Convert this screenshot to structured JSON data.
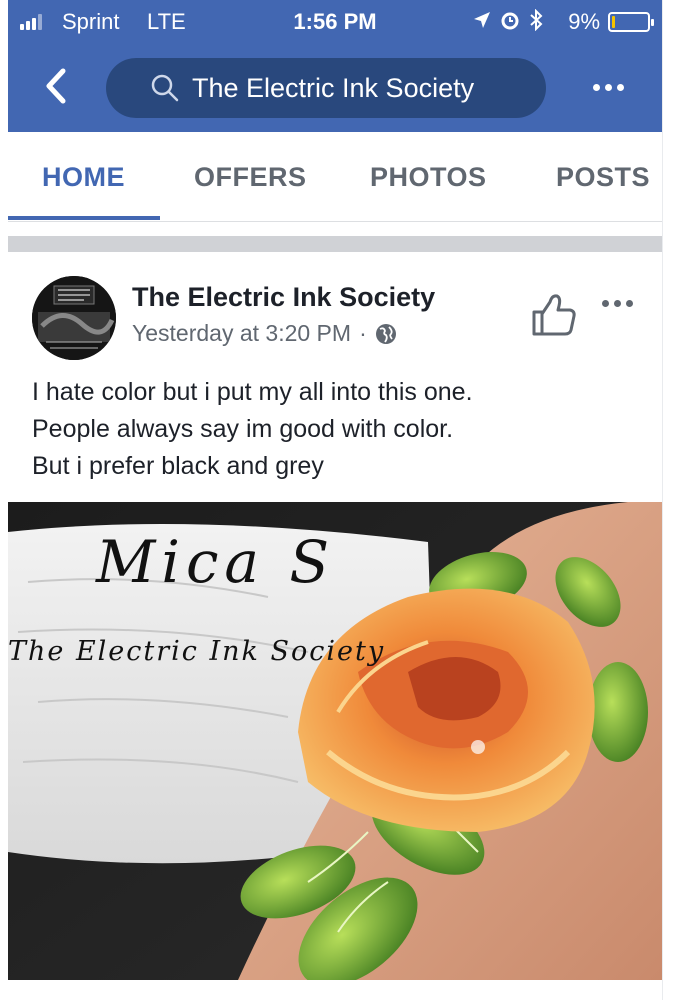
{
  "status_bar": {
    "carrier": "Sprint",
    "network": "LTE",
    "time": "1:56 PM",
    "battery": "9%",
    "battery_level": 0.09,
    "icons": [
      "signal-icon",
      "location-arrow-icon",
      "alarm-icon",
      "bluetooth-icon",
      "battery-icon"
    ]
  },
  "nav": {
    "search_text": "The Electric Ink Society",
    "back_icon": "chevron-left-icon",
    "search_icon": "search-icon",
    "more_icon": "more-dots-icon"
  },
  "tabs": [
    {
      "label": "HOME",
      "active": true
    },
    {
      "label": "OFFERS",
      "active": false
    },
    {
      "label": "PHOTOS",
      "active": false
    },
    {
      "label": "POSTS",
      "active": false
    }
  ],
  "post": {
    "author": "The Electric Ink Society",
    "timestamp": "Yesterday at 3:20 PM",
    "separator": "·",
    "privacy_icon": "globe-icon",
    "like_icon": "thumbs-up-icon",
    "more_icon": "more-dots-icon",
    "text_lines": [
      "I hate color but i put my all into this one.",
      "People always say im good with color.",
      "But i prefer black and grey"
    ],
    "photo": {
      "artist_signature": "Mica S",
      "shop_signature": "The Electric Ink Society"
    }
  },
  "colors": {
    "brand_blue": "#4267b2",
    "search_pill": "#29487d",
    "text_primary": "#1d2129",
    "text_secondary": "#606770",
    "rose_orange": "#f39a3c",
    "leaf_green": "#5f9a2a"
  }
}
